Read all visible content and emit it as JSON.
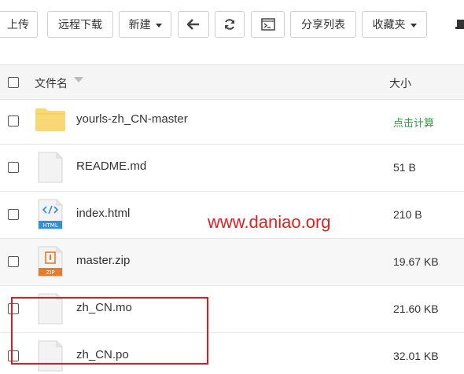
{
  "toolbar": {
    "upload_label": "上传",
    "remote_download_label": "远程下载",
    "new_label": "新建",
    "share_list_label": "分享列表",
    "favorites_label": "收藏夹"
  },
  "table": {
    "header": {
      "name_label": "文件名",
      "size_label": "大小"
    },
    "rows": [
      {
        "name": "yourls-zh_CN-master",
        "size": "点击计算",
        "icon": "folder-icon"
      },
      {
        "name": "README.md",
        "size": "51 B",
        "icon": "file-icon"
      },
      {
        "name": "index.html",
        "size": "210 B",
        "icon": "html-file-icon"
      },
      {
        "name": "master.zip",
        "size": "19.67 KB",
        "icon": "zip-file-icon"
      },
      {
        "name": "zh_CN.mo",
        "size": "21.60 KB",
        "icon": "file-icon"
      },
      {
        "name": "zh_CN.po",
        "size": "32.01 KB",
        "icon": "file-icon"
      }
    ]
  },
  "watermark": "www.daniao.org",
  "colors": {
    "folder": "#f8d775",
    "html_badge": "#2f8fd8",
    "zip_badge": "#e87b2a",
    "calc_link": "#2e9e3f",
    "watermark": "#e02020",
    "highlight_border": "#d81e1e"
  }
}
